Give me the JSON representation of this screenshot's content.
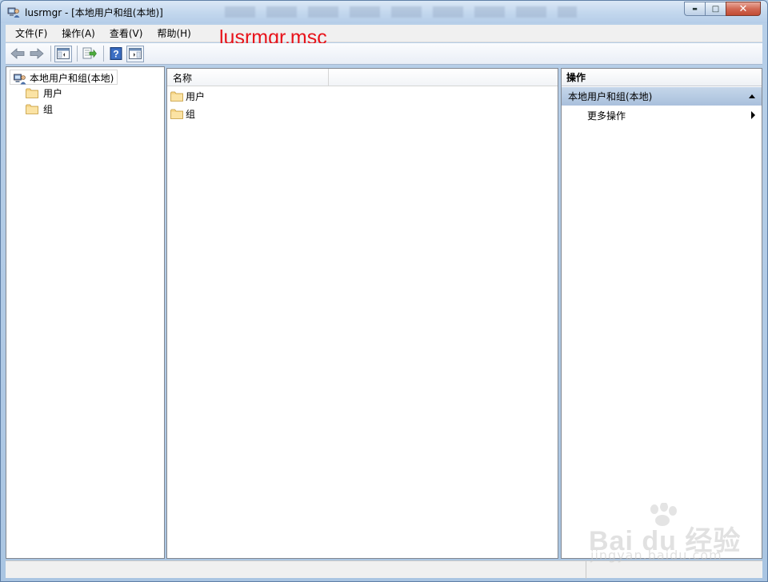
{
  "window": {
    "title": "lusrmgr - [本地用户和组(本地)]",
    "controls": {
      "minimize": "▬",
      "maximize": "□",
      "close": "✕"
    }
  },
  "menubar": {
    "items": [
      {
        "label": "文件(F)"
      },
      {
        "label": "操作(A)"
      },
      {
        "label": "查看(V)"
      },
      {
        "label": "帮助(H)"
      }
    ]
  },
  "annotation": {
    "caption": "lusrmgr.msc",
    "color": "#e8131a"
  },
  "toolbar": {
    "icons": [
      "back-arrow-icon",
      "forward-arrow-icon",
      "show-hide-tree-icon",
      "export-list-icon",
      "help-icon",
      "show-hide-action-pane-icon"
    ],
    "help_glyph": "?"
  },
  "tree": {
    "root": {
      "label": "本地用户和组(本地)",
      "icon": "users-groups-icon"
    },
    "children": [
      {
        "label": "用户",
        "icon": "folder-icon"
      },
      {
        "label": "组",
        "icon": "folder-icon"
      }
    ]
  },
  "list": {
    "columns": [
      {
        "label": "名称"
      }
    ],
    "rows": [
      {
        "name": "用户",
        "icon": "folder-icon"
      },
      {
        "name": "组",
        "icon": "folder-icon"
      }
    ]
  },
  "actions": {
    "header": "操作",
    "group": {
      "label": "本地用户和组(本地)",
      "color": "#b4c8e0"
    },
    "items": [
      {
        "label": "更多操作"
      }
    ]
  },
  "watermark": {
    "main": "Bai du 经验",
    "sub": "jingyan.baidu.com"
  }
}
